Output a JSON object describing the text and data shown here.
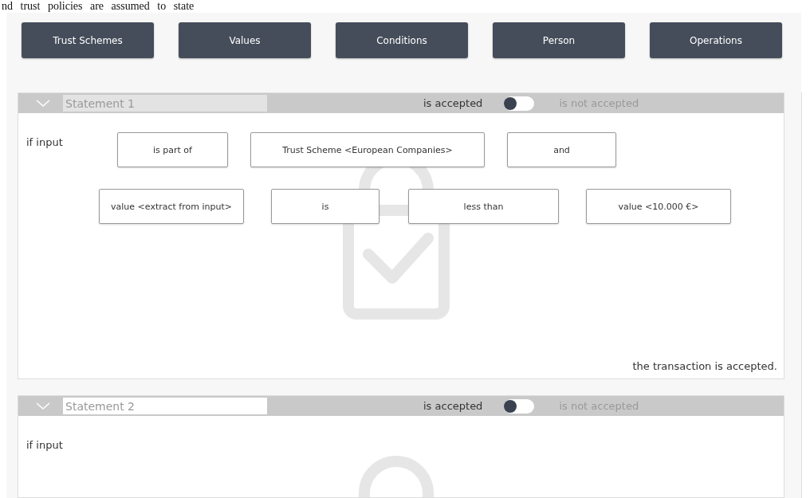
{
  "caption": "nd trust policies are assumed to state",
  "toolbar": [
    {
      "label": "Trust Schemes"
    },
    {
      "label": "Values"
    },
    {
      "label": "Conditions"
    },
    {
      "label": "Person"
    },
    {
      "label": "Operations"
    }
  ],
  "statements": [
    {
      "title": "Statement 1",
      "highlighted": true,
      "expanded": true,
      "accept_label": "is accepted",
      "reject_label": "is not accepted",
      "switch_on": false,
      "lead": "if input",
      "checked": true,
      "rows": [
        [
          "is part of",
          "Trust Scheme  <European Companies>",
          "and"
        ],
        [
          "value <extract from input>",
          "is",
          "less than",
          "value <10.000 €>"
        ]
      ],
      "result": "the transaction is accepted."
    },
    {
      "title": "Statement 2",
      "highlighted": false,
      "expanded": true,
      "accept_label": "is accepted",
      "reject_label": "is not accepted",
      "switch_on": false,
      "lead": "if input"
    }
  ]
}
